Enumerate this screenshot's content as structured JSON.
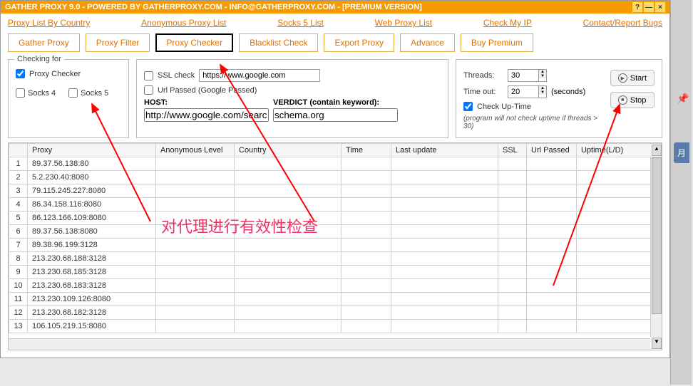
{
  "title": "GATHER PROXY 9.0 - POWERED BY GATHERPROXY.COM - INFO@GATHERPROXY.COM - [PREMIUM VERSION]",
  "links": {
    "country": "Proxy List By Country",
    "anon": "Anonymous Proxy List",
    "socks5": "Socks 5 List",
    "web": "Web Proxy List",
    "checkip": "Check My IP",
    "contact": "Contact/Report Bugs"
  },
  "tabs": {
    "gather": "Gather Proxy",
    "filter": "Proxy Filter",
    "checker": "Proxy Checker",
    "blacklist": "Blacklist Check",
    "export": "Export Proxy",
    "advance": "Advance",
    "premium": "Buy Premium"
  },
  "group1": {
    "legend": "Checking for",
    "proxyChecker": "Proxy Checker",
    "socks4": "Socks 4",
    "socks5": "Socks 5"
  },
  "group2": {
    "sslCheck": "SSL check",
    "sslUrl": "https://www.google.com",
    "urlPassed": "Url Passed (Google Passed)",
    "hostLabel": "HOST:",
    "hostVal": "http://www.google.com/search?pv",
    "verdictLabel": "VERDICT (contain keyword):",
    "verdictVal": "schema.org"
  },
  "group3": {
    "threadsLabel": "Threads:",
    "threadsVal": "30",
    "timeoutLabel": "Time out:",
    "timeoutVal": "20",
    "seconds": "(seconds)",
    "checkUptime": "Check Up-Time",
    "note": "(program will not check uptime if threads > 30)",
    "start": "Start",
    "stop": "Stop"
  },
  "columns": {
    "proxy": "Proxy",
    "anon": "Anonymous Level",
    "country": "Country",
    "time": "Time",
    "lastupdate": "Last update",
    "ssl": "SSL",
    "urlpassed": "Url Passed",
    "uptime": "Uptime(L/D)"
  },
  "rows": [
    "89.37.56.138:80",
    "5.2.230.40:8080",
    "79.115.245.227:8080",
    "86.34.158.116:8080",
    "86.123.166.109:8080",
    "89.37.56.138:8080",
    "89.38.96.199:3128",
    "213.230.68.188:3128",
    "213.230.68.185:3128",
    "213.230.68.183:3128",
    "213.230.109.126:8080",
    "213.230.68.182:3128",
    "106.105.219.15:8080"
  ],
  "annotation": "对代理进行有效性检查",
  "sidebarTab": "月"
}
